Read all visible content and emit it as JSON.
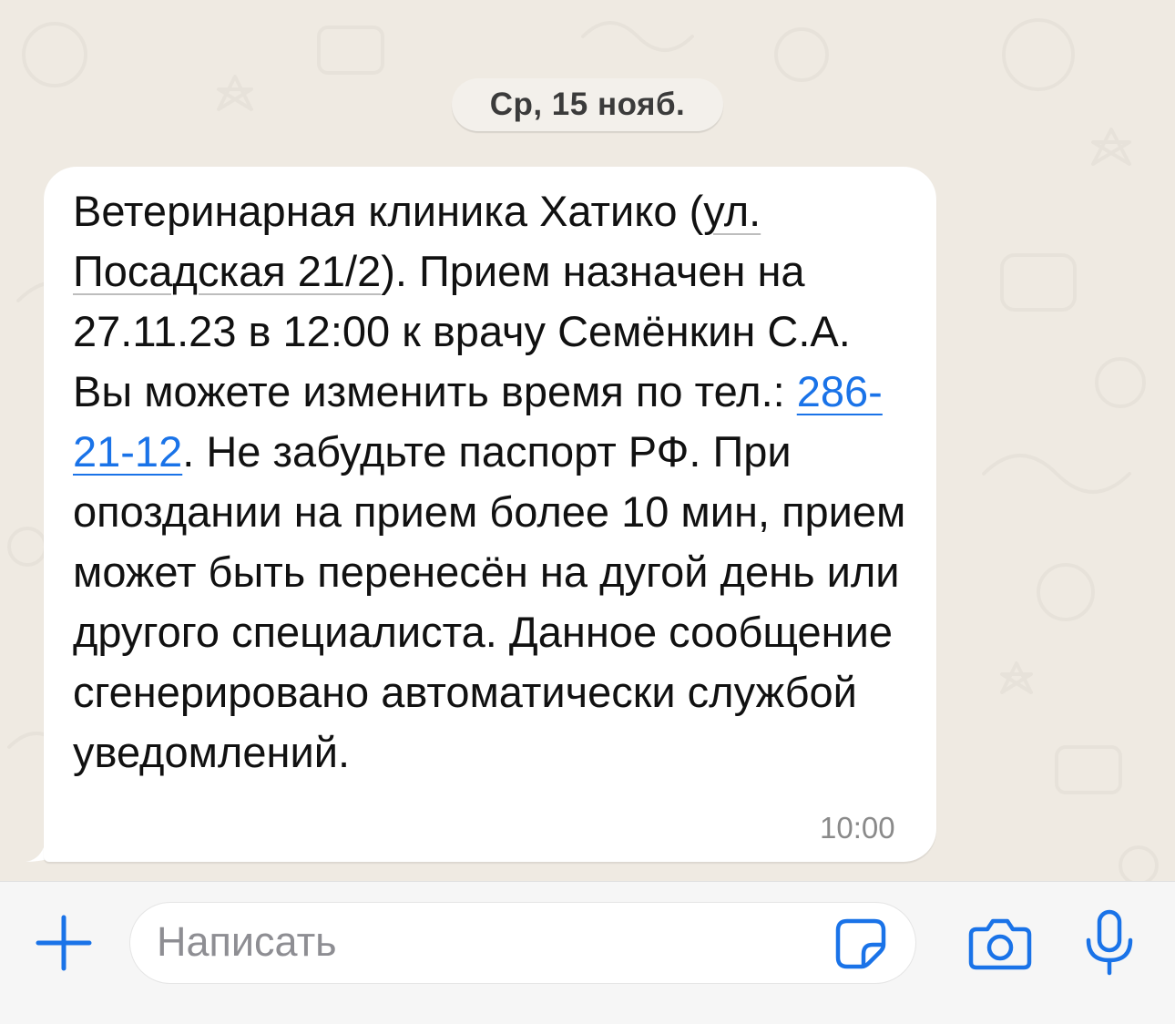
{
  "date_separator": "Ср, 15 нояб.",
  "message": {
    "text_before_address": "Ветеринарная клиника Хатико (",
    "address": "ул. Посадская 21/2",
    "text_after_address": "). Прием назначен на 27.11.23 в 12:00 к врачу Семёнкин С.А. Вы можете изменить время по тел.: ",
    "phone": "286-21-12",
    "text_after_phone": ". Не забудьте паспорт РФ. При опоздании на прием более 10 мин, прием может быть перенесён на дугой день или другого специалиста. Данное сообщение сгенерировано автоматически службой уведомлений.",
    "time": "10:00"
  },
  "composer": {
    "placeholder": "Написать",
    "icons": {
      "add": "plus-icon",
      "sticker": "sticker-icon",
      "camera": "camera-icon",
      "mic": "microphone-icon"
    }
  },
  "colors": {
    "accent": "#1a73e8",
    "chat_background": "#efeae2",
    "bubble": "#ffffff"
  }
}
